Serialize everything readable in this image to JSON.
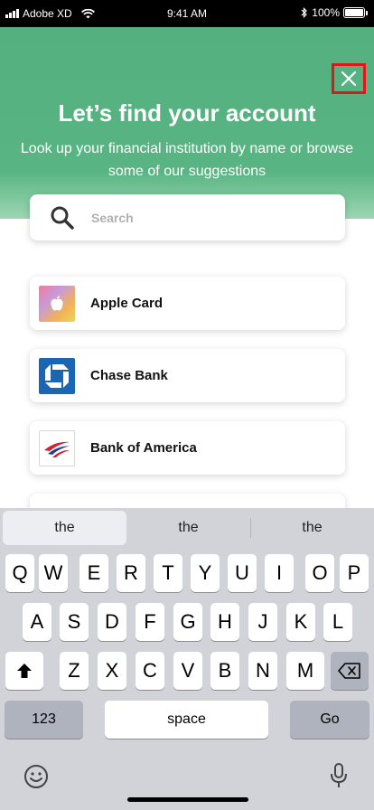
{
  "status_bar": {
    "carrier": "Adobe XD",
    "time": "9:41 AM",
    "battery": "100%",
    "icons": [
      "signal-icon",
      "wifi-icon",
      "bluetooth-icon",
      "battery-icon"
    ]
  },
  "header": {
    "title": "Let’s find your account",
    "subtitle": "Look up your financial institution by name or browse some of our suggestions",
    "close_icon": "close-icon",
    "colors": {
      "background": "#55b07f",
      "close_border": "#e0161b"
    }
  },
  "search": {
    "placeholder": "Search",
    "value": "",
    "icon": "search-icon"
  },
  "banks": [
    {
      "name": "Apple Card",
      "icon": "apple-logo-icon"
    },
    {
      "name": "Chase Bank",
      "icon": "chase-logo-icon"
    },
    {
      "name": "Bank of America",
      "icon": "bank-of-america-logo-icon"
    }
  ],
  "keyboard": {
    "suggestions": [
      "the",
      "the",
      "the"
    ],
    "row1": [
      "Q",
      "W",
      "E",
      "R",
      "T",
      "Y",
      "U",
      "I",
      "O",
      "P"
    ],
    "row2": [
      "A",
      "S",
      "D",
      "F",
      "G",
      "H",
      "J",
      "K",
      "L"
    ],
    "row3": [
      "Z",
      "X",
      "C",
      "V",
      "B",
      "N",
      "M"
    ],
    "numbers_label": "123",
    "space_label": "space",
    "go_label": "Go",
    "icons": [
      "shift-icon",
      "backspace-icon",
      "emoji-icon",
      "microphone-icon"
    ]
  }
}
